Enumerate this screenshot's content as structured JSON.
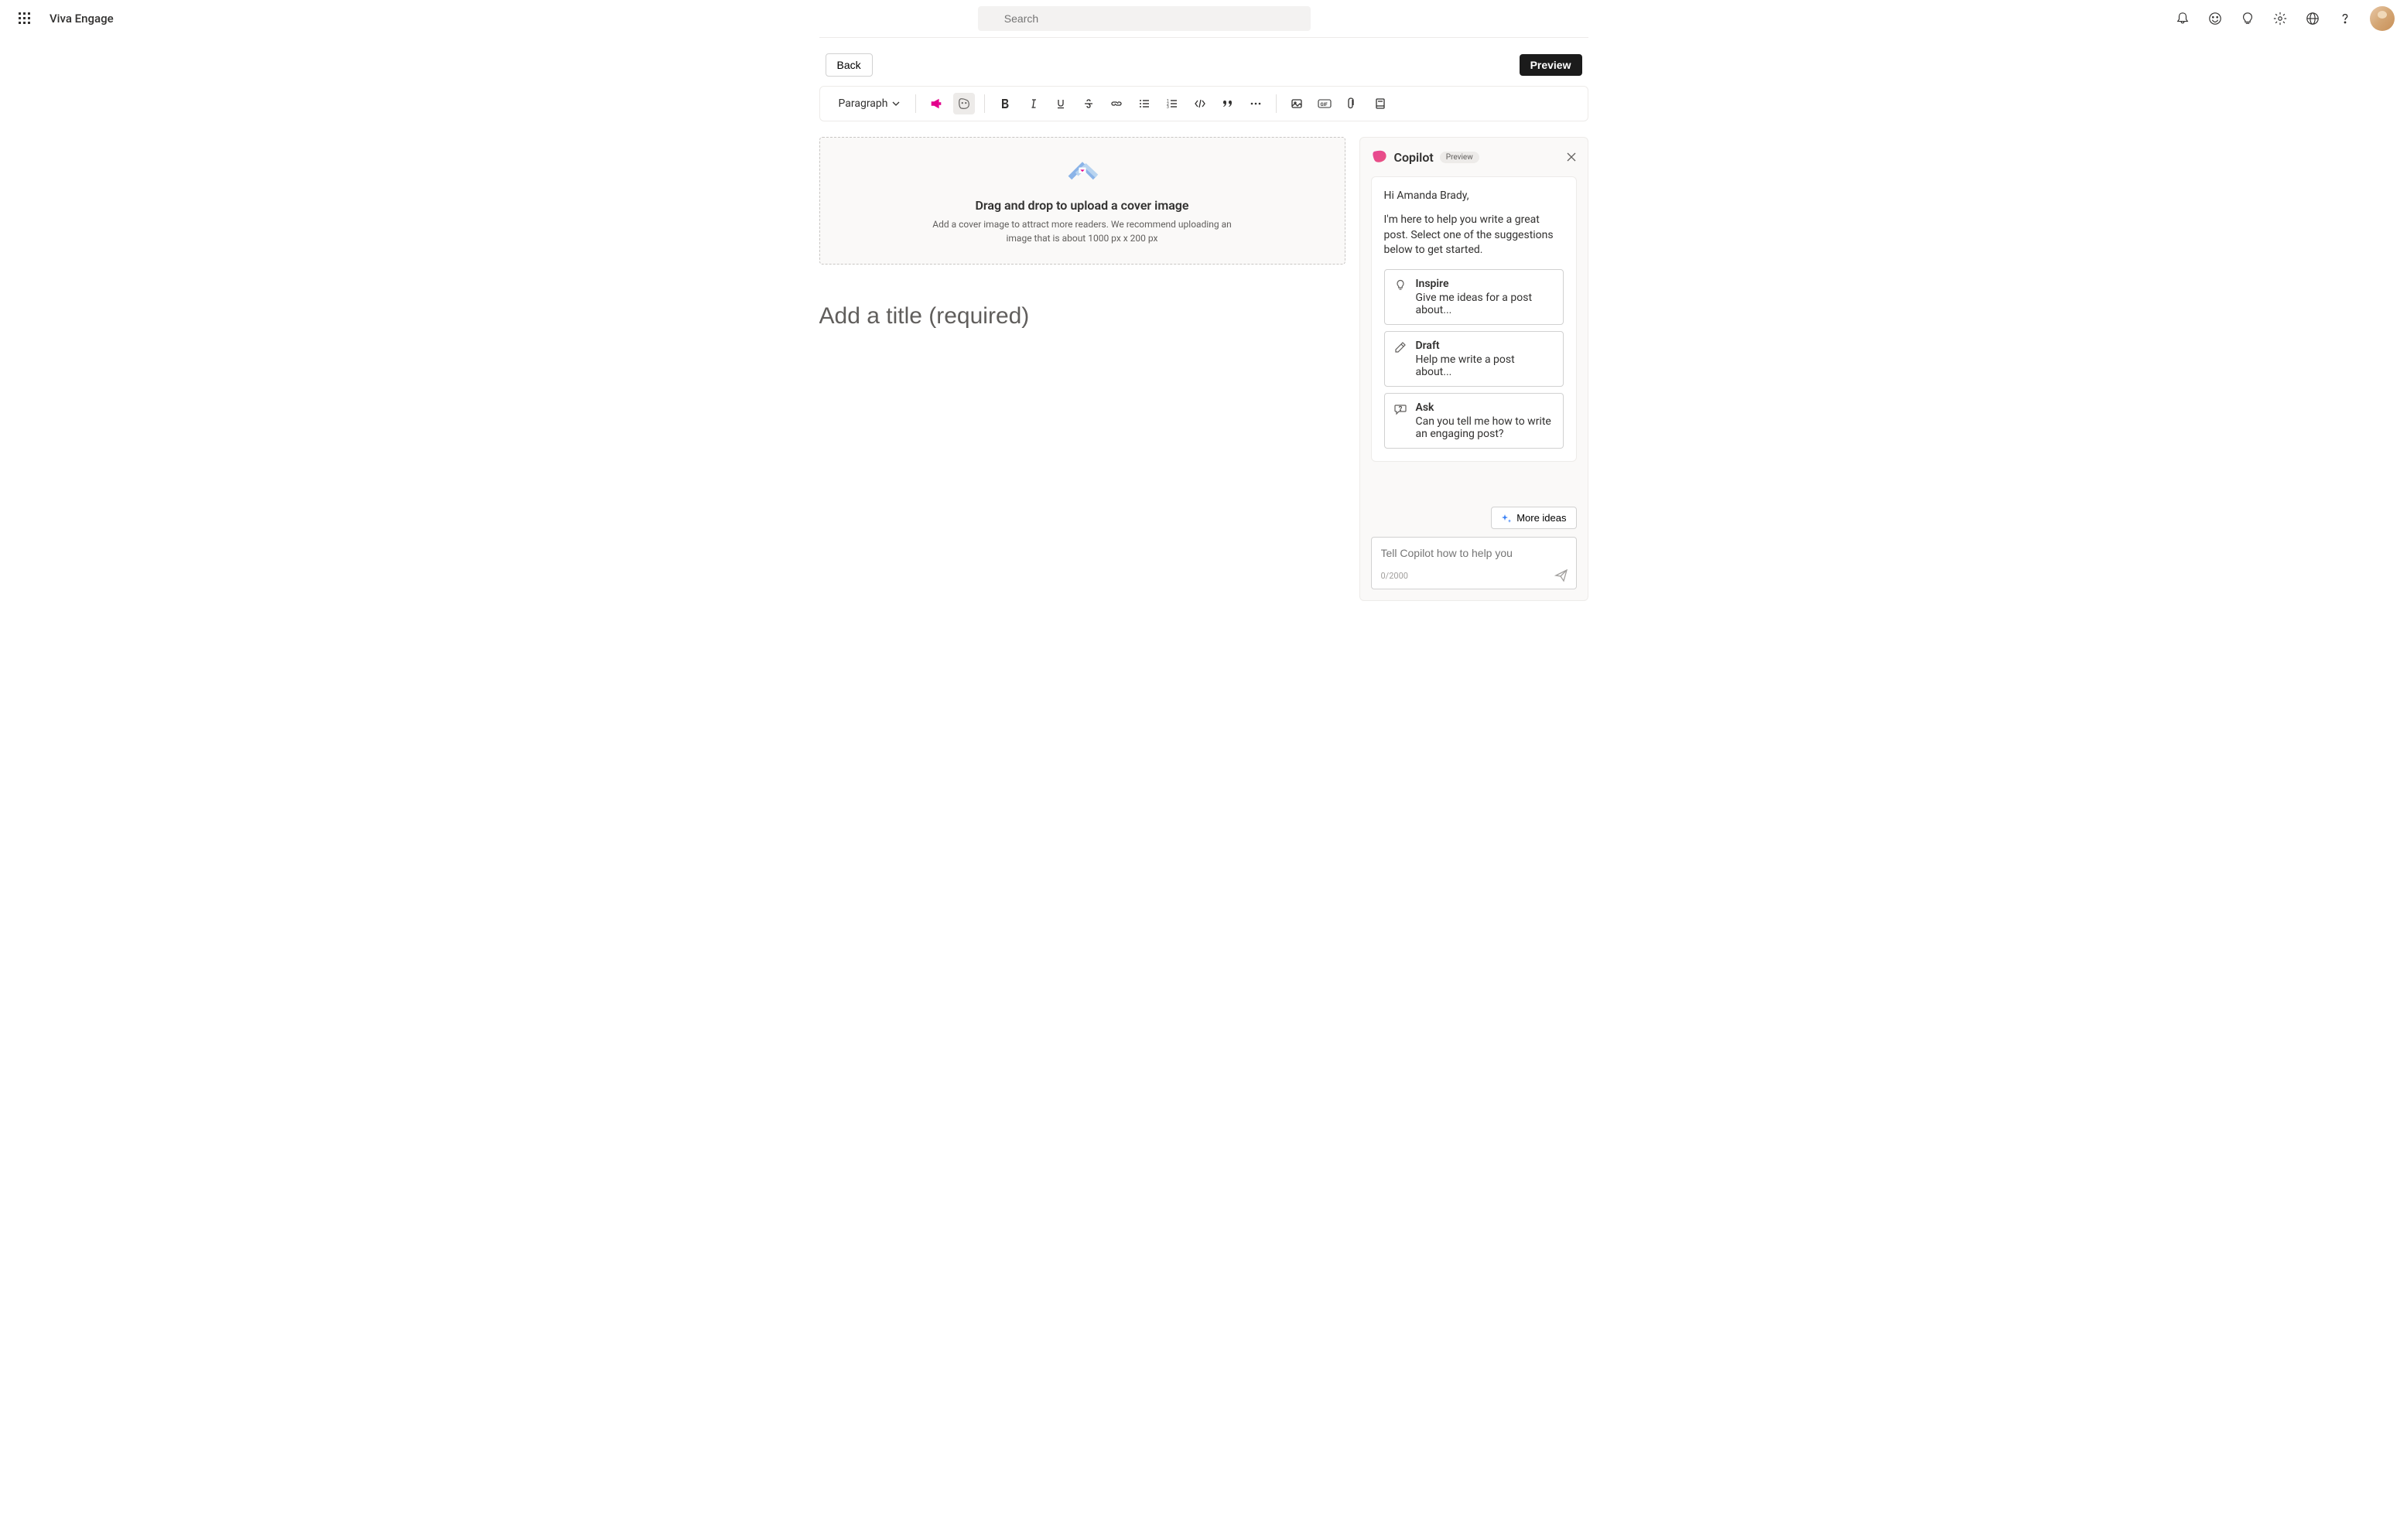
{
  "app_title": "Viva Engage",
  "search_placeholder": "Search",
  "back_label": "Back",
  "preview_label": "Preview",
  "toolbar": {
    "paragraph_label": "Paragraph"
  },
  "cover": {
    "title": "Drag and drop to upload a cover image",
    "subtitle": "Add a cover image to attract more readers. We recommend uploading an image that is about 1000 px x 200 px"
  },
  "title_placeholder": "Add a title (required)",
  "copilot": {
    "title": "Copilot",
    "badge": "Preview",
    "greeting": "Hi Amanda Brady,",
    "intro": "I'm here to help you write a great post. Select one of the suggestions below to get started.",
    "suggestions": [
      {
        "title": "Inspire",
        "desc": "Give me ideas for a post about..."
      },
      {
        "title": "Draft",
        "desc": "Help me write a post about..."
      },
      {
        "title": "Ask",
        "desc": "Can you tell me how to write an engaging post?"
      }
    ],
    "more_ideas_label": "More ideas",
    "input_placeholder": "Tell Copilot how to help you",
    "char_count": "0/2000"
  }
}
